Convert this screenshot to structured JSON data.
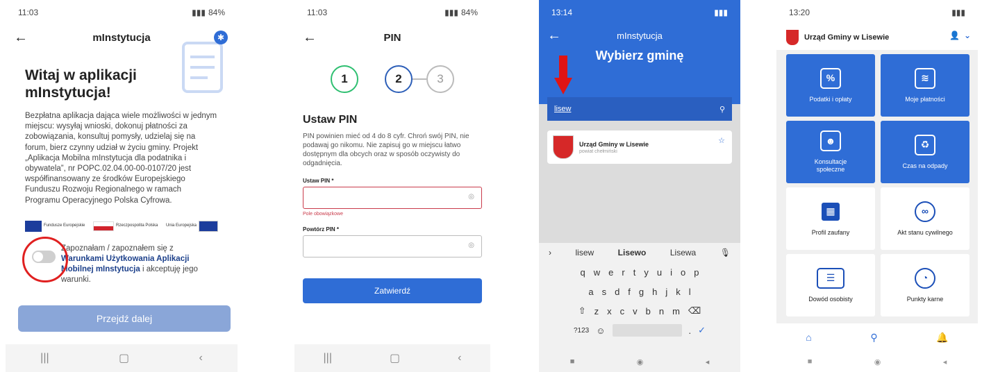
{
  "screen1": {
    "time": "11:03",
    "battery": "84%",
    "title": "mInstytucja",
    "heading": "Witaj w aplikacji mInstytucja!",
    "description": "Bezpłatna aplikacja dająca wiele możliwości w jednym miejscu: wysyłaj wnioski, dokonuj płatności za zobowiązania, konsultuj pomysły, udzielaj się na forum, bierz czynny udział w życiu gminy. Projekt „Aplikacja Mobilna mInstytucja dla podatnika i obywatela”, nr POPC.02.04.00-00-0107/20 jest współfinansowany ze środków Europejskiego Funduszu Rozwoju Regionalnego w ramach Programu Operacyjnego Polska Cyfrowa.",
    "logo1": "Fundusze Europejskie",
    "logo2": "Rzeczpospolita Polska",
    "logo3": "Unia Europejska",
    "consent_pre": "Zapoznałam / zapoznałem się z",
    "consent_link": "Warunkami Użytkowania Aplikacji Mobilnej mInstytucja",
    "consent_post": "i akceptuję jego warunki.",
    "button": "Przejdź dalej"
  },
  "screen2": {
    "time": "11:03",
    "battery": "84%",
    "title": "PIN",
    "step1": "1",
    "step2": "2",
    "step3": "3",
    "heading": "Ustaw PIN",
    "hint": "PIN powinien mieć od 4 do 8 cyfr. Chroń swój PIN, nie podawaj go nikomu. Nie zapisuj go w miejscu łatwo dostępnym dla obcych oraz w sposób oczywisty do odgadnięcia.",
    "pin_label": "Ustaw PIN *",
    "pin_error": "Pole obowiązkowe",
    "repeat_label": "Powtórz PIN *",
    "button": "Zatwierdź"
  },
  "screen3": {
    "time": "13:14",
    "title": "mInstytucja",
    "heading": "Wybierz gminę",
    "search_value": "lisew",
    "result_name": "Urząd Gminy w Lisewie",
    "result_sub": "powiat chełmiński",
    "suggestions": [
      "lisew",
      "Lisewo",
      "Lisewa"
    ],
    "row1": [
      "q",
      "w",
      "e",
      "r",
      "t",
      "y",
      "u",
      "i",
      "o",
      "p"
    ],
    "row2": [
      "a",
      "s",
      "d",
      "f",
      "g",
      "h",
      "j",
      "k",
      "l"
    ],
    "row3": [
      "z",
      "x",
      "c",
      "v",
      "b",
      "n",
      "m"
    ],
    "key_numbers": "?123"
  },
  "screen4": {
    "time": "13:20",
    "org": "Urząd Gminy w Lisewie",
    "tiles": [
      {
        "label": "Podatki i opłaty"
      },
      {
        "label": "Moje płatności"
      },
      {
        "label": "Konsultacje społeczne"
      },
      {
        "label": "Czas na odpady"
      },
      {
        "label": "Profil zaufany"
      },
      {
        "label": "Akt stanu cywilnego"
      },
      {
        "label": "Dowód osobisty"
      },
      {
        "label": "Punkty karne"
      }
    ]
  }
}
